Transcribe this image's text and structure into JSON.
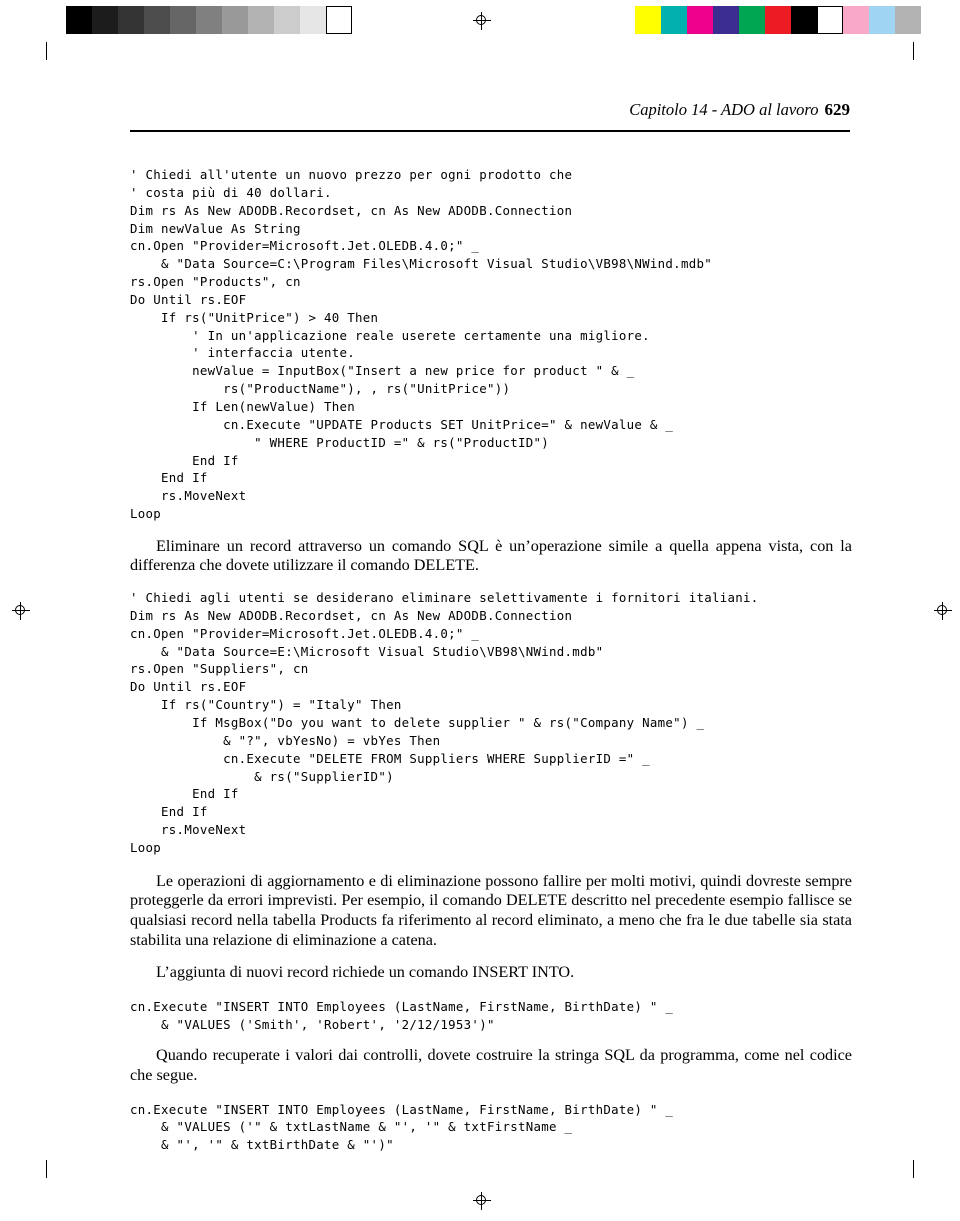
{
  "calibration": {
    "gray_swatches": [
      "#000000",
      "#1c1c1c",
      "#333333",
      "#4d4d4d",
      "#666666",
      "#808080",
      "#999999",
      "#b3b3b3",
      "#cccccc",
      "#e6e6e6",
      "#ffffff"
    ],
    "color_swatches": [
      "#ffff00",
      "#00b1b0",
      "#ec008c",
      "#3b2d8f",
      "#00a651",
      "#ed1c24",
      "#000000",
      "#ffffff",
      "#f9a8c8",
      "#9fd5f2",
      "#b3b3b3"
    ]
  },
  "header": {
    "chapter_title": "Capitolo 14 - ADO al lavoro",
    "page_number": "629"
  },
  "content": {
    "code_block_1": "' Chiedi all'utente un nuovo prezzo per ogni prodotto che\n' costa più di 40 dollari.\nDim rs As New ADODB.Recordset, cn As New ADODB.Connection\nDim newValue As String\ncn.Open \"Provider=Microsoft.Jet.OLEDB.4.0;\" _\n    & \"Data Source=C:\\Program Files\\Microsoft Visual Studio\\VB98\\NWind.mdb\"\nrs.Open \"Products\", cn\nDo Until rs.EOF\n    If rs(\"UnitPrice\") > 40 Then\n        ' In un'applicazione reale userete certamente una migliore.\n        ' interfaccia utente.\n        newValue = InputBox(\"Insert a new price for product \" & _\n            rs(\"ProductName\"), , rs(\"UnitPrice\"))\n        If Len(newValue) Then\n            cn.Execute \"UPDATE Products SET UnitPrice=\" & newValue & _\n                \" WHERE ProductID =\" & rs(\"ProductID\")\n        End If\n    End If\n    rs.MoveNext\nLoop",
    "paragraph_1": "Eliminare un record attraverso un comando SQL è un’operazione simile a quella appena vista, con la differenza che dovete utilizzare il comando DELETE.",
    "code_block_2": "' Chiedi agli utenti se desiderano eliminare selettivamente i fornitori italiani.\nDim rs As New ADODB.Recordset, cn As New ADODB.Connection\ncn.Open \"Provider=Microsoft.Jet.OLEDB.4.0;\" _\n    & \"Data Source=E:\\Microsoft Visual Studio\\VB98\\NWind.mdb\"\nrs.Open \"Suppliers\", cn\nDo Until rs.EOF\n    If rs(\"Country\") = \"Italy\" Then\n        If MsgBox(\"Do you want to delete supplier \" & rs(\"Company Name\") _\n            & \"?\", vbYesNo) = vbYes Then\n            cn.Execute \"DELETE FROM Suppliers WHERE SupplierID =\" _\n                & rs(\"SupplierID\")\n        End If\n    End If\n    rs.MoveNext\nLoop",
    "paragraph_2": "Le operazioni di aggiornamento e di eliminazione possono fallire per molti motivi, quindi dovreste sempre proteggerle da errori imprevisti. Per esempio, il comando DELETE descritto nel precedente esempio fallisce se qualsiasi record nella tabella Products fa riferimento al record eliminato, a meno che fra le due tabelle sia stata stabilita una relazione di eliminazione a catena.",
    "paragraph_3": "L’aggiunta di nuovi record richiede un comando INSERT INTO.",
    "code_block_3": "cn.Execute \"INSERT INTO Employees (LastName, FirstName, BirthDate) \" _\n    & \"VALUES ('Smith', 'Robert', '2/12/1953')\"",
    "paragraph_4": "Quando recuperate i valori dai controlli, dovete costruire la stringa SQL da programma, come nel codice che segue.",
    "code_block_4": "cn.Execute \"INSERT INTO Employees (LastName, FirstName, BirthDate) \" _\n    & \"VALUES ('\" & txtLastName & \"', '\" & txtFirstName _\n    & \"', '\" & txtBirthDate & \"')\""
  }
}
